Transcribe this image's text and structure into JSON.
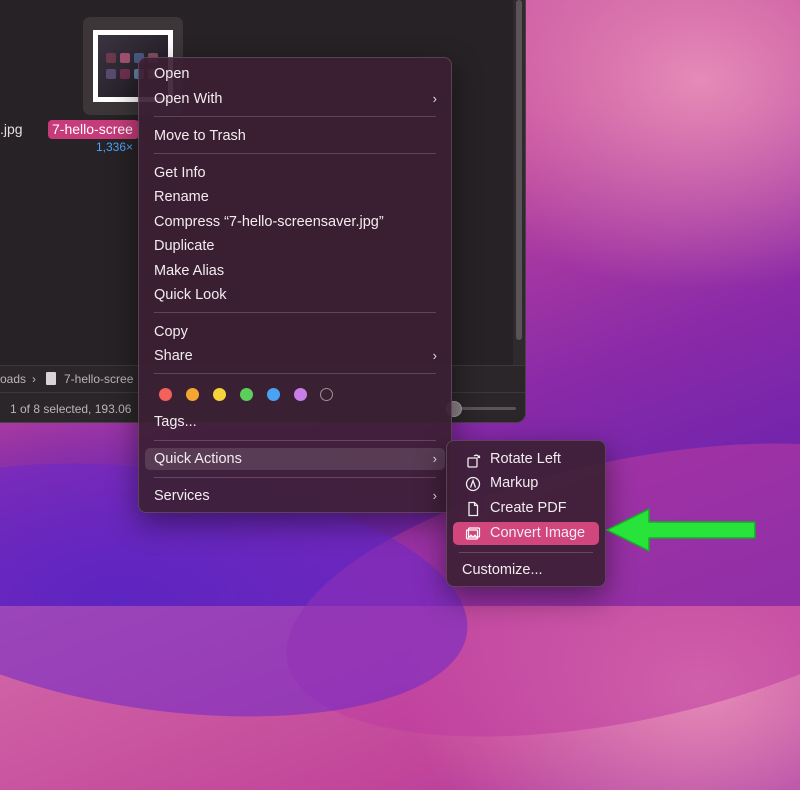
{
  "finder": {
    "left_file_name": ".jpg",
    "selected_file_name": "7-hello-scree",
    "selected_file_dims": "1,336×",
    "path": {
      "folder": "oads",
      "separator": "›",
      "file": "7-hello-scree"
    },
    "status": "1 of 8 selected, 193.06"
  },
  "context_menu": {
    "open": "Open",
    "open_with": "Open With",
    "move_to_trash": "Move to Trash",
    "get_info": "Get Info",
    "rename": "Rename",
    "compress": "Compress “7-hello-screensaver.jpg”",
    "duplicate": "Duplicate",
    "make_alias": "Make Alias",
    "quick_look": "Quick Look",
    "copy": "Copy",
    "share": "Share",
    "tags": "Tags...",
    "quick_actions": "Quick Actions",
    "services": "Services",
    "chevron": "›",
    "tag_colors": [
      "#f2625b",
      "#f5a532",
      "#f6d33b",
      "#5bcf5a",
      "#4aa3f2",
      "#c77ee8"
    ]
  },
  "quick_actions_menu": {
    "rotate_left": "Rotate Left",
    "markup": "Markup",
    "create_pdf": "Create PDF",
    "convert_image": "Convert Image",
    "customize": "Customize..."
  },
  "colors": {
    "selection_pink": "#c73b7b",
    "active_item": "#d0467d",
    "arrow_green": "#27e33a"
  }
}
